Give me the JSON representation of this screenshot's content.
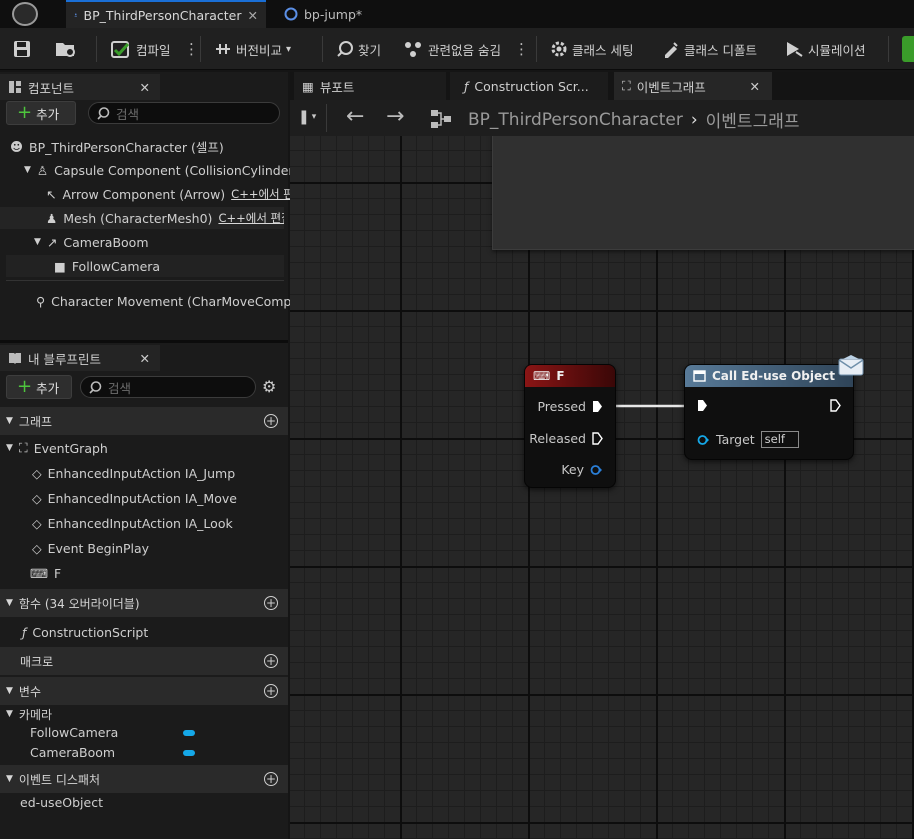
{
  "titlebar": {
    "tabs": [
      {
        "label": "BP_ThirdPersonCharacter"
      },
      {
        "label": "bp-jump*"
      }
    ]
  },
  "toolbar": {
    "compile": "컴파일",
    "diff": "버전비교",
    "find": "찾기",
    "hide_unrelated": "관련없음 숨김",
    "class_settings": "클래스 세팅",
    "class_defaults": "클래스 디폴트",
    "simulation": "시뮬레이션"
  },
  "components": {
    "tab": "컴포넌트",
    "add": "추가",
    "search_placeholder": "검색",
    "tree": [
      {
        "label": "BP_ThirdPersonCharacter (셀프)",
        "icon": "character-icon"
      },
      {
        "label": "Capsule Component (CollisionCylinder)",
        "icon": "capsule-icon"
      },
      {
        "label": "Arrow Component (Arrow)",
        "suffix": "C++에서 편",
        "icon": "arrow-icon"
      },
      {
        "label": "Mesh (CharacterMesh0)",
        "suffix": "C++에서 편집",
        "icon": "mesh-icon"
      },
      {
        "label": "CameraBoom",
        "icon": "spring-arm-icon"
      },
      {
        "label": "FollowCamera",
        "icon": "camera-icon"
      },
      {
        "label": "Character Movement (CharMoveComp)",
        "icon": "movement-icon"
      }
    ]
  },
  "blueprint": {
    "tab": "내 블루프린트",
    "add": "추가",
    "search_placeholder": "검색",
    "graphs_header": "그래프",
    "event_graph": "EventGraph",
    "events": [
      "EnhancedInputAction IA_Jump",
      "EnhancedInputAction IA_Move",
      "EnhancedInputAction IA_Look",
      "Event BeginPlay",
      "F"
    ],
    "functions_header": "함수 (34 오버라이더블)",
    "construction_script": "ConstructionScript",
    "macros_header": "매크로",
    "variables_header": "변수",
    "var_category": "카메라",
    "variables": [
      "FollowCamera",
      "CameraBoom"
    ],
    "dispatchers_header": "이벤트 디스패처",
    "dispatcher": "ed-useObject"
  },
  "graph": {
    "tabs": [
      "뷰포트",
      "Construction Scr...",
      "이벤트그래프"
    ],
    "breadcrumb_root": "BP_ThirdPersonCharacter",
    "breadcrumb_leaf": "이벤트그래프",
    "key_node": {
      "title": "F",
      "pins": [
        "Pressed",
        "Released",
        "Key"
      ]
    },
    "call_node": {
      "title": "Call Ed-use Object",
      "target_label": "Target",
      "target_value": "self"
    }
  },
  "colors": {
    "accent": "#1a6fd6",
    "key_node_header": "#7a1010",
    "call_node_header": "#46627c",
    "object_pin": "#15a8e8",
    "compile_green": "#3a9c2a"
  }
}
